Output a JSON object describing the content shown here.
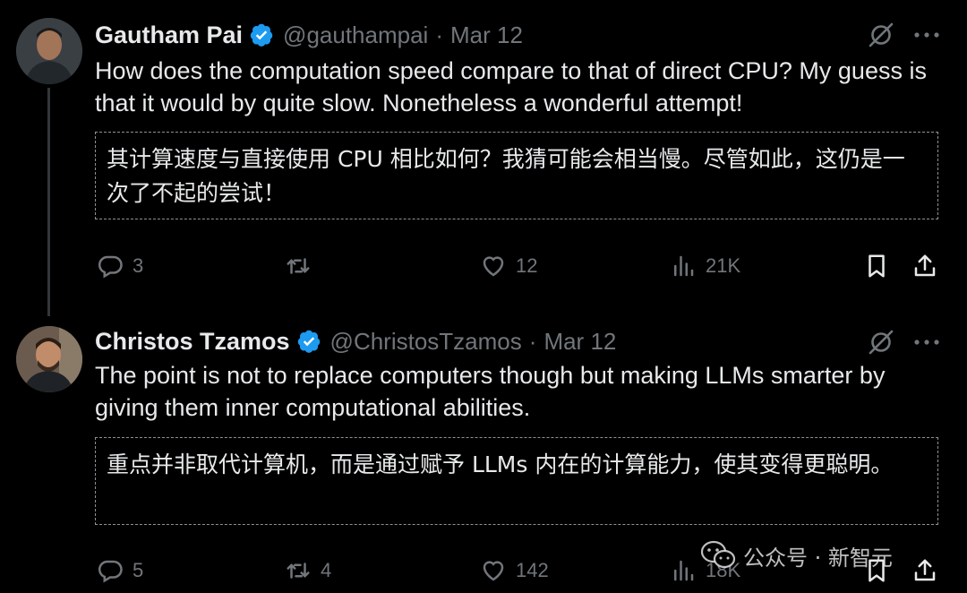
{
  "tweets": [
    {
      "name": "Gautham Pai",
      "handle": "@gauthampai",
      "separator": "·",
      "date": "Mar 12",
      "text": "How does the computation speed compare to that of direct CPU? My guess is that it would by quite slow. Nonetheless a wonderful attempt!",
      "translation": "其计算速度与直接使用 CPU 相比如何？我猜可能会相当慢。尽管如此，这仍是一次了不起的尝试！",
      "replies": "3",
      "retweets": "",
      "likes": "12",
      "views": "21K"
    },
    {
      "name": "Christos Tzamos",
      "handle": "@ChristosTzamos",
      "separator": "·",
      "date": "Mar 12",
      "text": "The point is not to replace computers though but making LLMs smarter by giving them inner computational abilities.",
      "translation": "重点并非取代计算机，而是通过赋予 LLMs 内在的计算能力，使其变得更聪明。",
      "replies": "5",
      "retweets": "4",
      "likes": "142",
      "views": "18K"
    }
  ],
  "watermark": {
    "text": "公众号 · 新智元"
  },
  "colors": {
    "background": "#000000",
    "text": "#e7e9ea",
    "muted": "#71767b",
    "verified": "#1d9bf0"
  },
  "icons": [
    "verified-badge-icon",
    "grok-icon",
    "more-icon",
    "reply-icon",
    "retweet-icon",
    "like-icon",
    "views-icon",
    "bookmark-icon",
    "share-icon",
    "wechat-icon"
  ]
}
